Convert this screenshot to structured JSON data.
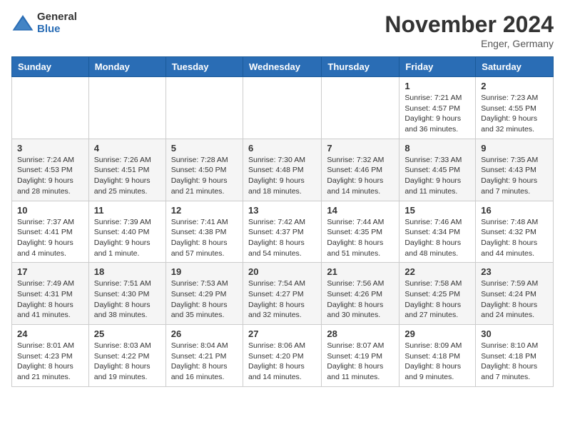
{
  "header": {
    "logo_general": "General",
    "logo_blue": "Blue",
    "month_title": "November 2024",
    "location": "Enger, Germany"
  },
  "days_of_week": [
    "Sunday",
    "Monday",
    "Tuesday",
    "Wednesday",
    "Thursday",
    "Friday",
    "Saturday"
  ],
  "weeks": [
    [
      {
        "day": "",
        "info": ""
      },
      {
        "day": "",
        "info": ""
      },
      {
        "day": "",
        "info": ""
      },
      {
        "day": "",
        "info": ""
      },
      {
        "day": "",
        "info": ""
      },
      {
        "day": "1",
        "info": "Sunrise: 7:21 AM\nSunset: 4:57 PM\nDaylight: 9 hours and 36 minutes."
      },
      {
        "day": "2",
        "info": "Sunrise: 7:23 AM\nSunset: 4:55 PM\nDaylight: 9 hours and 32 minutes."
      }
    ],
    [
      {
        "day": "3",
        "info": "Sunrise: 7:24 AM\nSunset: 4:53 PM\nDaylight: 9 hours and 28 minutes."
      },
      {
        "day": "4",
        "info": "Sunrise: 7:26 AM\nSunset: 4:51 PM\nDaylight: 9 hours and 25 minutes."
      },
      {
        "day": "5",
        "info": "Sunrise: 7:28 AM\nSunset: 4:50 PM\nDaylight: 9 hours and 21 minutes."
      },
      {
        "day": "6",
        "info": "Sunrise: 7:30 AM\nSunset: 4:48 PM\nDaylight: 9 hours and 18 minutes."
      },
      {
        "day": "7",
        "info": "Sunrise: 7:32 AM\nSunset: 4:46 PM\nDaylight: 9 hours and 14 minutes."
      },
      {
        "day": "8",
        "info": "Sunrise: 7:33 AM\nSunset: 4:45 PM\nDaylight: 9 hours and 11 minutes."
      },
      {
        "day": "9",
        "info": "Sunrise: 7:35 AM\nSunset: 4:43 PM\nDaylight: 9 hours and 7 minutes."
      }
    ],
    [
      {
        "day": "10",
        "info": "Sunrise: 7:37 AM\nSunset: 4:41 PM\nDaylight: 9 hours and 4 minutes."
      },
      {
        "day": "11",
        "info": "Sunrise: 7:39 AM\nSunset: 4:40 PM\nDaylight: 9 hours and 1 minute."
      },
      {
        "day": "12",
        "info": "Sunrise: 7:41 AM\nSunset: 4:38 PM\nDaylight: 8 hours and 57 minutes."
      },
      {
        "day": "13",
        "info": "Sunrise: 7:42 AM\nSunset: 4:37 PM\nDaylight: 8 hours and 54 minutes."
      },
      {
        "day": "14",
        "info": "Sunrise: 7:44 AM\nSunset: 4:35 PM\nDaylight: 8 hours and 51 minutes."
      },
      {
        "day": "15",
        "info": "Sunrise: 7:46 AM\nSunset: 4:34 PM\nDaylight: 8 hours and 48 minutes."
      },
      {
        "day": "16",
        "info": "Sunrise: 7:48 AM\nSunset: 4:32 PM\nDaylight: 8 hours and 44 minutes."
      }
    ],
    [
      {
        "day": "17",
        "info": "Sunrise: 7:49 AM\nSunset: 4:31 PM\nDaylight: 8 hours and 41 minutes."
      },
      {
        "day": "18",
        "info": "Sunrise: 7:51 AM\nSunset: 4:30 PM\nDaylight: 8 hours and 38 minutes."
      },
      {
        "day": "19",
        "info": "Sunrise: 7:53 AM\nSunset: 4:29 PM\nDaylight: 8 hours and 35 minutes."
      },
      {
        "day": "20",
        "info": "Sunrise: 7:54 AM\nSunset: 4:27 PM\nDaylight: 8 hours and 32 minutes."
      },
      {
        "day": "21",
        "info": "Sunrise: 7:56 AM\nSunset: 4:26 PM\nDaylight: 8 hours and 30 minutes."
      },
      {
        "day": "22",
        "info": "Sunrise: 7:58 AM\nSunset: 4:25 PM\nDaylight: 8 hours and 27 minutes."
      },
      {
        "day": "23",
        "info": "Sunrise: 7:59 AM\nSunset: 4:24 PM\nDaylight: 8 hours and 24 minutes."
      }
    ],
    [
      {
        "day": "24",
        "info": "Sunrise: 8:01 AM\nSunset: 4:23 PM\nDaylight: 8 hours and 21 minutes."
      },
      {
        "day": "25",
        "info": "Sunrise: 8:03 AM\nSunset: 4:22 PM\nDaylight: 8 hours and 19 minutes."
      },
      {
        "day": "26",
        "info": "Sunrise: 8:04 AM\nSunset: 4:21 PM\nDaylight: 8 hours and 16 minutes."
      },
      {
        "day": "27",
        "info": "Sunrise: 8:06 AM\nSunset: 4:20 PM\nDaylight: 8 hours and 14 minutes."
      },
      {
        "day": "28",
        "info": "Sunrise: 8:07 AM\nSunset: 4:19 PM\nDaylight: 8 hours and 11 minutes."
      },
      {
        "day": "29",
        "info": "Sunrise: 8:09 AM\nSunset: 4:18 PM\nDaylight: 8 hours and 9 minutes."
      },
      {
        "day": "30",
        "info": "Sunrise: 8:10 AM\nSunset: 4:18 PM\nDaylight: 8 hours and 7 minutes."
      }
    ]
  ]
}
